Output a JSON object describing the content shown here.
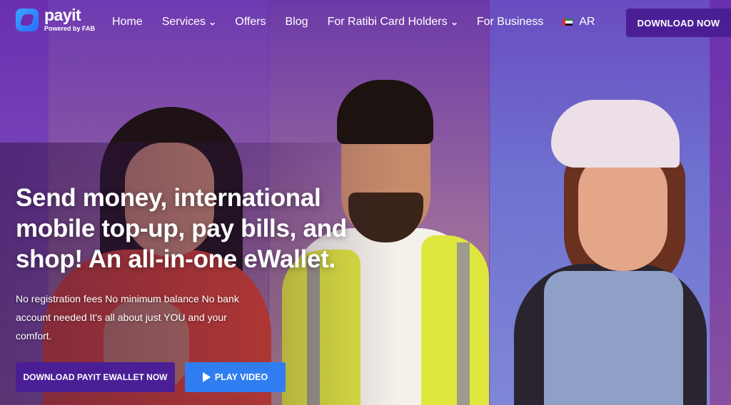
{
  "brand": {
    "name": "payit",
    "tagline": "Powered by FAB"
  },
  "nav": {
    "items": [
      {
        "label": "Home",
        "dropdown": false
      },
      {
        "label": "Services",
        "dropdown": true
      },
      {
        "label": "Offers",
        "dropdown": false
      },
      {
        "label": "Blog",
        "dropdown": false
      },
      {
        "label": "For Ratibi Card Holders",
        "dropdown": true
      },
      {
        "label": "For Business",
        "dropdown": false
      }
    ],
    "language": "AR",
    "download_label": "DOWNLOAD NOW"
  },
  "hero": {
    "headline": "Send money, international mobile top-up, pay bills, and shop! An all-in-one eWallet.",
    "subtext": "No registration fees No minimum balance No bank account needed It's all about just YOU and your comfort.",
    "cta_download": "DOWNLOAD PAYIT EWALLET NOW",
    "cta_video": "PLAY VIDEO"
  },
  "colors": {
    "primary": "#4a1f96",
    "accent_blue": "#2f7df0",
    "background_purple": "#6a2fb0"
  },
  "icons": [
    "payit-logo-icon",
    "chevron-down-icon",
    "uae-flag-icon",
    "play-icon"
  ]
}
